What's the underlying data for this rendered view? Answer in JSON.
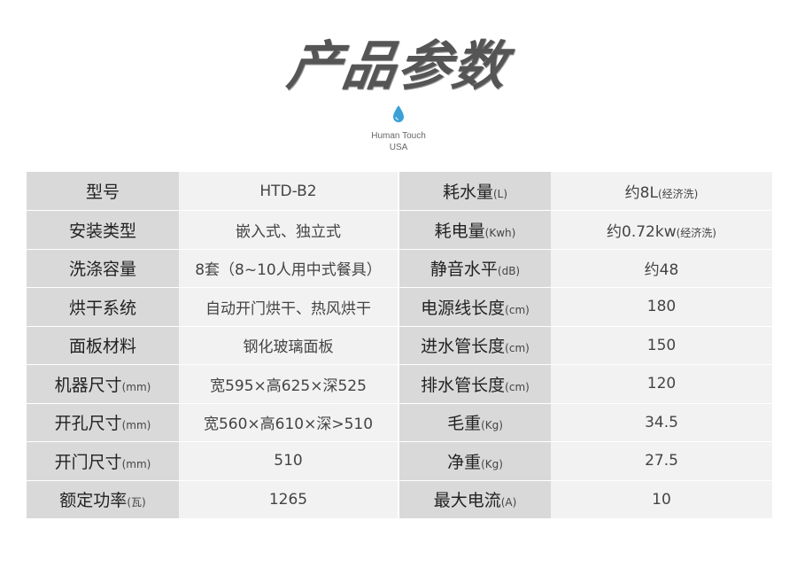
{
  "page": {
    "title": "产品参数",
    "brand_line1": "Human Touch",
    "brand_line2": "USA",
    "brand_icon": "water-drop-icon",
    "accent_color": "#3aa0d8"
  },
  "specs": [
    {
      "k1": "型号",
      "u1": "",
      "v1": "HTD-B2",
      "v1u": "",
      "k2": "耗水量",
      "u2": "(L)",
      "v2": "约8L",
      "v2u": "(经济洗)"
    },
    {
      "k1": "安装类型",
      "u1": "",
      "v1": "嵌入式、独立式",
      "v1u": "",
      "k2": "耗电量",
      "u2": "(Kwh)",
      "v2": "约0.72kw",
      "v2u": "(经济洗)"
    },
    {
      "k1": "洗涤容量",
      "u1": "",
      "v1": "8套（8~10人用中式餐具）",
      "v1u": "",
      "k2": "静音水平",
      "u2": "(dB)",
      "v2": "约48",
      "v2u": ""
    },
    {
      "k1": "烘干系统",
      "u1": "",
      "v1": "自动开门烘干、热风烘干",
      "v1u": "",
      "k2": "电源线长度",
      "u2": "(cm)",
      "v2": "180",
      "v2u": ""
    },
    {
      "k1": "面板材料",
      "u1": "",
      "v1": "钢化玻璃面板",
      "v1u": "",
      "k2": "进水管长度",
      "u2": "(cm)",
      "v2": "150",
      "v2u": ""
    },
    {
      "k1": "机器尺寸",
      "u1": "(mm)",
      "v1": "宽595×高625×深525",
      "v1u": "",
      "k2": "排水管长度",
      "u2": "(cm)",
      "v2": "120",
      "v2u": ""
    },
    {
      "k1": "开孔尺寸",
      "u1": "(mm)",
      "v1": "宽560×高610×深>510",
      "v1u": "",
      "k2": "毛重",
      "u2": "(Kg)",
      "v2": "34.5",
      "v2u": ""
    },
    {
      "k1": "开门尺寸",
      "u1": "(mm)",
      "v1": "510",
      "v1u": "",
      "k2": "净重",
      "u2": "(Kg)",
      "v2": "27.5",
      "v2u": ""
    },
    {
      "k1": "额定功率",
      "u1": "(瓦)",
      "v1": "1265",
      "v1u": "",
      "k2": "最大电流",
      "u2": "(A)",
      "v2": "10",
      "v2u": ""
    }
  ]
}
